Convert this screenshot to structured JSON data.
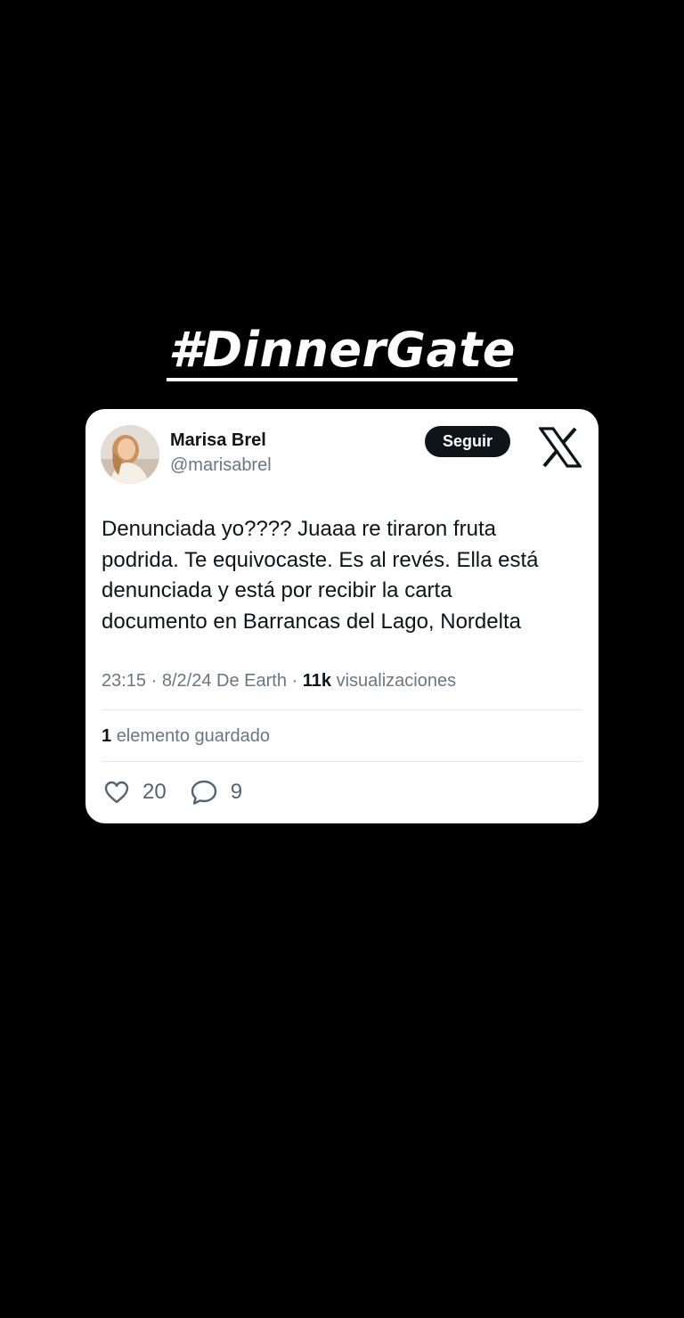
{
  "hashtag": "#DinnerGate",
  "post": {
    "author_name": "Marisa Brel",
    "author_handle": "@marisabrel",
    "follow_label": "Seguir",
    "text": "Denunciada yo???? Juaaa re tiraron fruta\npodrida.  Te equivocaste. Es al revés. Ella está\ndenunciada y está por recibir la carta\ndocumento en Barrancas del Lago, Nordelta",
    "meta": {
      "time": "23:15",
      "date": "8/2/24",
      "source": "De Earth",
      "views_count": "11k",
      "views_label": "visualizaciones",
      "separator": " · "
    },
    "saved": {
      "count": "1",
      "label": "elemento guardado"
    },
    "likes": "20",
    "replies": "9"
  },
  "icons": {
    "brand": "x-logo-icon",
    "like": "heart-icon",
    "reply": "comment-icon"
  },
  "colors": {
    "background": "#000000",
    "card": "#ffffff",
    "text_primary": "#0f1419",
    "text_secondary": "#6b7680",
    "button": "#0f1419"
  }
}
